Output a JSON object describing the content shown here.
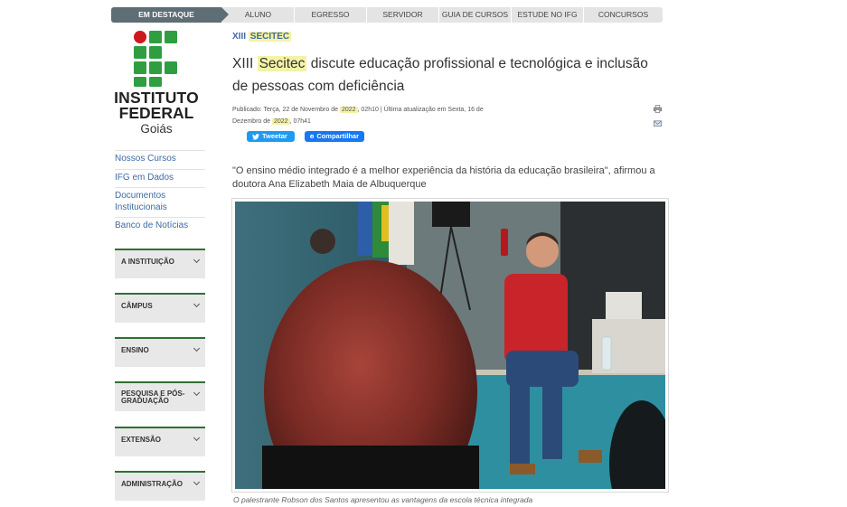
{
  "topnav": {
    "items": [
      "EM DESTAQUE",
      "ALUNO",
      "EGRESSO",
      "SERVIDOR",
      "GUIA DE CURSOS",
      "ESTUDE NO IFG",
      "CONCURSOS"
    ]
  },
  "logo": {
    "line1": "INSTITUTO",
    "line2": "FEDERAL",
    "line3": "Goiás"
  },
  "sidebar": {
    "links": [
      "Nossos Cursos",
      "IFG em Dados",
      "Documentos Institucionais",
      "Banco de Notícias"
    ],
    "sections": [
      "A INSTITUIÇÃO",
      "CÂMPUS",
      "ENSINO",
      "PESQUISA E PÓS-GRADUAÇÃO",
      "EXTENSÃO",
      "ADMINISTRAÇÃO"
    ]
  },
  "article": {
    "breadcrumb": {
      "prefix": "XIII",
      "highlight": "SECITEC"
    },
    "title": {
      "prefix": "XIII",
      "highlight": "Secitec",
      "rest": "discute educação profissional e tecnológica e inclusão de pessoas com deficiência"
    },
    "meta": {
      "published_prefix": "Publicado: Terça, 22 de Novembro de",
      "year": "2022",
      "published_suffix": ", 02h10 | Última atualização em Sexta, 16 de Dezembro de",
      "year2": "2022",
      "updated_suffix": ", 07h41"
    },
    "share": {
      "tweet": "Tweetar",
      "facebook": "Compartilhar"
    },
    "lead": "\"O ensino médio integrado é a melhor experiência da história da educação brasileira\", afirmou a doutora Ana Elizabeth Maia de Albuquerque",
    "caption": "O palestrante Robson dos Santos apresentou as vantagens da escola técnica integrada"
  },
  "icons": {
    "print": "print-icon",
    "email": "email-icon",
    "twitter": "twitter-bird-icon",
    "facebook": "facebook-f-icon",
    "chevron": "chevron-down-icon"
  },
  "colors": {
    "brand_green": "#2f9e41",
    "brand_red": "#cd191e",
    "nav_active": "#5f6d74",
    "link_blue": "#3f6ba3",
    "highlight": "#f4f2a6"
  }
}
